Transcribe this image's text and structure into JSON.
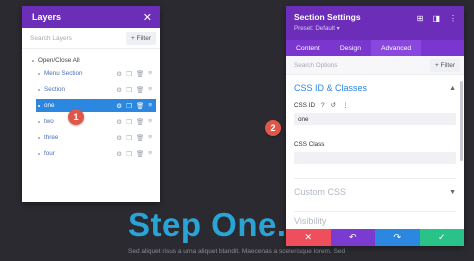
{
  "background": {
    "hero_text": "Step One.",
    "body_text": "Sed aliquet risus a urna aliquet blandit. Maecenas a scelerisque lorem. Sed"
  },
  "layers_panel": {
    "title": "Layers",
    "close_glyph": "✕",
    "search_placeholder": "Search Layers",
    "filter_label": "+ Filter",
    "open_close_all": "Open/Close All",
    "rows": [
      {
        "label": "Menu Section",
        "active": false
      },
      {
        "label": "Section",
        "active": false
      },
      {
        "label": "one",
        "active": true
      },
      {
        "label": "two",
        "active": false
      },
      {
        "label": "three",
        "active": false
      },
      {
        "label": "four",
        "active": false
      }
    ],
    "row_icons": [
      "gear-icon",
      "copy-icon",
      "trash-icon",
      "menu-icon"
    ]
  },
  "settings_panel": {
    "title": "Section Settings",
    "preset": "Preset: Default ▾",
    "header_controls": [
      "⊞",
      "◨",
      "⋮"
    ],
    "tabs": [
      "Content",
      "Design",
      "Advanced"
    ],
    "active_tab": "Advanced",
    "search_placeholder": "Search Options",
    "filter_label": "+ Filter",
    "css_section": {
      "title": "CSS ID & Classes",
      "css_id_label": "CSS ID",
      "css_id_value": "one",
      "css_class_label": "CSS Class",
      "css_class_value": ""
    },
    "custom_css_title": "Custom CSS",
    "visibility_title": "Visibility"
  },
  "badges": {
    "one": "1",
    "two": "2"
  },
  "colors": {
    "purple": "#6c2eb9",
    "active_blue": "#2b87e0",
    "badge_red": "#e0574a",
    "footer": [
      "#ef4f5c",
      "#7b3ad0",
      "#2b87e0",
      "#29c38a"
    ]
  }
}
